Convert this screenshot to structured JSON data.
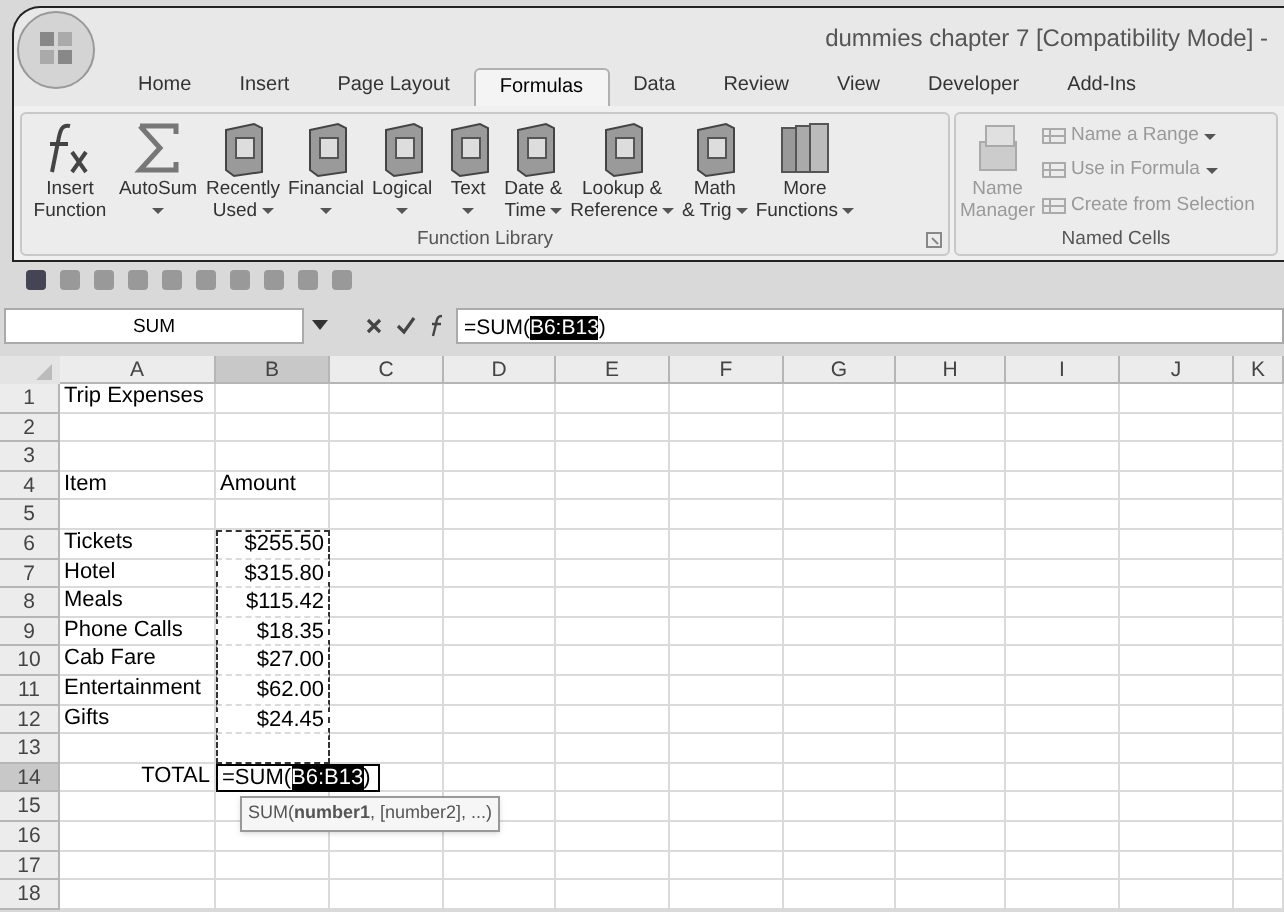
{
  "window": {
    "title": "dummies chapter 7  [Compatibility Mode] -"
  },
  "tabs": [
    {
      "label": "Home",
      "selected": false
    },
    {
      "label": "Insert",
      "selected": false
    },
    {
      "label": "Page Layout",
      "selected": false
    },
    {
      "label": "Formulas",
      "selected": true
    },
    {
      "label": "Data",
      "selected": false
    },
    {
      "label": "Review",
      "selected": false
    },
    {
      "label": "View",
      "selected": false
    },
    {
      "label": "Developer",
      "selected": false
    },
    {
      "label": "Add-Ins",
      "selected": false
    }
  ],
  "function_library": {
    "label": "Function Library",
    "buttons": [
      {
        "kind": "fx",
        "lines": [
          "Insert",
          "Function"
        ],
        "dropdown": false
      },
      {
        "kind": "sigma",
        "lines": [
          "AutoSum"
        ],
        "dropdown": true
      },
      {
        "kind": "book",
        "lines": [
          "Recently",
          "Used"
        ],
        "dropdown": true
      },
      {
        "kind": "book",
        "lines": [
          "Financial"
        ],
        "dropdown": true
      },
      {
        "kind": "book",
        "lines": [
          "Logical"
        ],
        "dropdown": true
      },
      {
        "kind": "book",
        "lines": [
          "Text"
        ],
        "dropdown": true
      },
      {
        "kind": "book",
        "lines": [
          "Date &",
          "Time"
        ],
        "dropdown": true
      },
      {
        "kind": "book",
        "lines": [
          "Lookup &",
          "Reference"
        ],
        "dropdown": true
      },
      {
        "kind": "book",
        "lines": [
          "Math",
          "& Trig"
        ],
        "dropdown": true
      },
      {
        "kind": "books",
        "lines": [
          "More",
          "Functions"
        ],
        "dropdown": true
      }
    ]
  },
  "named_cells": {
    "label": "Named Cells",
    "manager": {
      "lines": [
        "Name",
        "Manager"
      ],
      "disabled": true
    },
    "items": [
      {
        "label": "Name a Range",
        "dropdown": true,
        "disabled": true
      },
      {
        "label": "Use in Formula",
        "dropdown": true,
        "disabled": true
      },
      {
        "label": "Create from Selection",
        "dropdown": false,
        "disabled": true
      }
    ]
  },
  "formula_bar": {
    "name_box": "SUM",
    "formula": "=SUM(",
    "formula_ref": "B6:B13",
    "formula_end": ")"
  },
  "columns": [
    {
      "label": "A",
      "selected": false
    },
    {
      "label": "B",
      "selected": true
    },
    {
      "label": "C",
      "selected": false
    },
    {
      "label": "D",
      "selected": false
    },
    {
      "label": "E",
      "selected": false
    },
    {
      "label": "F",
      "selected": false
    },
    {
      "label": "G",
      "selected": false
    },
    {
      "label": "H",
      "selected": false
    },
    {
      "label": "I",
      "selected": false
    },
    {
      "label": "J",
      "selected": false
    },
    {
      "label": "K",
      "selected": false
    }
  ],
  "rows": [
    {
      "number": "1",
      "kind": "plain",
      "a": "Trip Expenses",
      "selected": false,
      "marquee": false
    },
    {
      "number": "2",
      "kind": "plain",
      "selected": false,
      "marquee": false
    },
    {
      "number": "3",
      "kind": "plain",
      "selected": false,
      "marquee": false
    },
    {
      "number": "4",
      "kind": "plain",
      "a": "Item",
      "b": "Amount",
      "selected": false,
      "marquee": false
    },
    {
      "number": "5",
      "kind": "plain",
      "selected": false,
      "marquee": false
    },
    {
      "number": "6",
      "kind": "value",
      "a": "Tickets",
      "b": "$255.50",
      "selected": false,
      "marquee": true
    },
    {
      "number": "7",
      "kind": "value",
      "a": "Hotel",
      "b": "$315.80",
      "selected": false,
      "marquee": true
    },
    {
      "number": "8",
      "kind": "value",
      "a": "Meals",
      "b": "$115.42",
      "selected": false,
      "marquee": true
    },
    {
      "number": "9",
      "kind": "value",
      "a": "Phone Calls",
      "b": "$18.35",
      "selected": false,
      "marquee": true
    },
    {
      "number": "10",
      "kind": "value",
      "a": "Cab Fare",
      "b": "$27.00",
      "selected": false,
      "marquee": true
    },
    {
      "number": "11",
      "kind": "value",
      "a": "Entertainment",
      "b": "$62.00",
      "selected": false,
      "marquee": true
    },
    {
      "number": "12",
      "kind": "value",
      "a": "Gifts",
      "b": "$24.45",
      "selected": false,
      "marquee": true
    },
    {
      "number": "13",
      "kind": "plain",
      "selected": false,
      "marquee": true
    },
    {
      "number": "14",
      "kind": "total",
      "a": "TOTAL",
      "b": "=SUM(",
      "b_ref": "B6:B13",
      "b_end": ")",
      "tooltip": "SUM(**number1**, [number2], ...)",
      "selected": true,
      "marquee": false
    },
    {
      "number": "15",
      "kind": "plain",
      "selected": false,
      "marquee": false
    },
    {
      "number": "16",
      "kind": "plain",
      "selected": false,
      "marquee": false
    },
    {
      "number": "17",
      "kind": "plain",
      "selected": false,
      "marquee": false
    },
    {
      "number": "18",
      "kind": "plain",
      "selected": false,
      "marquee": false
    }
  ]
}
